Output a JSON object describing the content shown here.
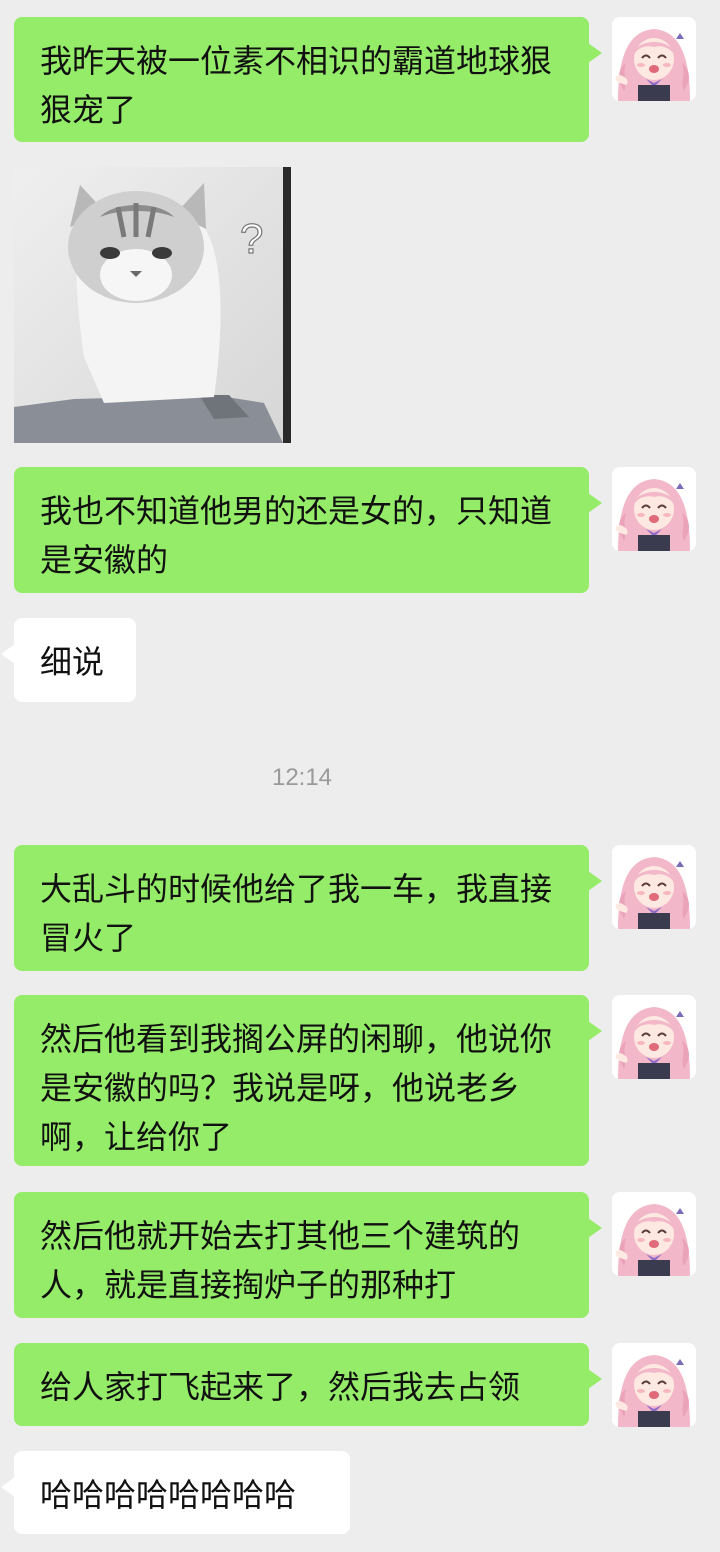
{
  "messages": [
    {
      "text": "我昨天被一位素不相识的霸道地球狠狠宠了"
    },
    {
      "sticker_glyph": "?"
    },
    {
      "text": "我也不知道他男的还是女的，只知道是安徽的"
    },
    {
      "text": "细说"
    },
    {
      "text": "大乱斗的时候他给了我一车，我直接冒火了"
    },
    {
      "text": "然后他看到我搁公屏的闲聊，他说你是安徽的吗？我说是呀，他说老乡啊，让给你了"
    },
    {
      "text": "然后他就开始去打其他三个建筑的人，就是直接掏炉子的那种打"
    },
    {
      "text": "给人家打飞起来了，然后我去占领"
    },
    {
      "text": "哈哈哈哈哈哈哈哈"
    }
  ],
  "timestamp": "12:14",
  "colors": {
    "background": "#ededed",
    "outgoing_bubble": "#95ec69",
    "incoming_bubble": "#ffffff",
    "timestamp_text": "#9a9a9a"
  }
}
